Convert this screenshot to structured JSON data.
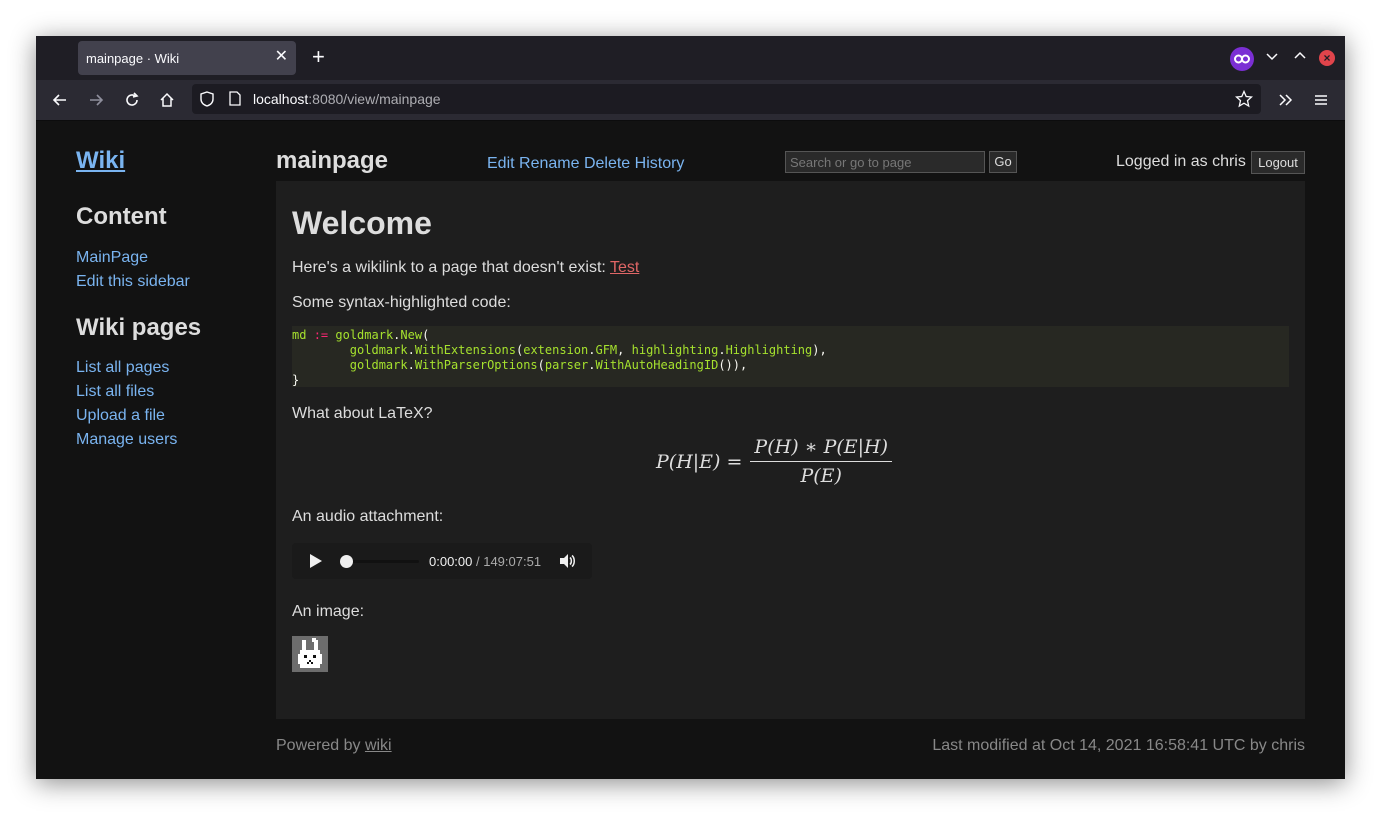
{
  "browser": {
    "tab_title": "mainpage · Wiki",
    "tab_close": "✕",
    "new_tab": "+",
    "url_host": "localhost",
    "url_rest": ":8080/view/mainpage",
    "icons": [
      "back-icon",
      "forward-icon",
      "reload-icon",
      "home-icon",
      "shield-icon",
      "page-icon",
      "star-icon",
      "overflow-icon",
      "menu-icon",
      "private-browsing-icon",
      "chevron-down-icon",
      "chevron-up-icon",
      "close-icon"
    ]
  },
  "sidebar": {
    "site_title": "Wiki",
    "content_heading": "Content",
    "content_links": [
      "MainPage",
      "Edit this sidebar"
    ],
    "wiki_heading": "Wiki pages",
    "wiki_links": [
      "List all pages",
      "List all files",
      "Upload a file",
      "Manage users"
    ]
  },
  "header": {
    "page_title": "mainpage",
    "actions": [
      "Edit",
      "Rename",
      "Delete",
      "History"
    ],
    "search_placeholder": "Search or go to page",
    "go_label": "Go",
    "logged_in": "Logged in as chris",
    "logout_label": "Logout"
  },
  "article": {
    "heading": "Welcome",
    "wikilink_text": "Here's a wikilink to a page that doesn't exist: ",
    "wikilink_label": "Test",
    "code_intro": "Some syntax-highlighted code:",
    "code_lines": [
      "md := goldmark.New(",
      "        goldmark.WithExtensions(extension.GFM, highlighting.Highlighting),",
      "        goldmark.WithParserOptions(parser.WithAutoHeadingID()),",
      "}"
    ],
    "latex_intro": "What about LaTeX?",
    "latex_lhs": "P(H|E) =",
    "latex_num": "P(H) ∗ P(E|H)",
    "latex_den": "P(E)",
    "audio_intro": "An audio attachment:",
    "audio_current": "0:00:00",
    "audio_duration": " / 149:07:51",
    "audio_progress": 0,
    "image_intro": "An image:"
  },
  "footer": {
    "powered_prefix": "Powered by ",
    "powered_link": "wiki",
    "last_modified": "Last modified at Oct 14, 2021 16:58:41 UTC by chris"
  },
  "colors": {
    "link": "#7ab4f0",
    "missing_link": "#e06666",
    "page_bg": "#121212",
    "content_bg": "#1e1e1e"
  }
}
